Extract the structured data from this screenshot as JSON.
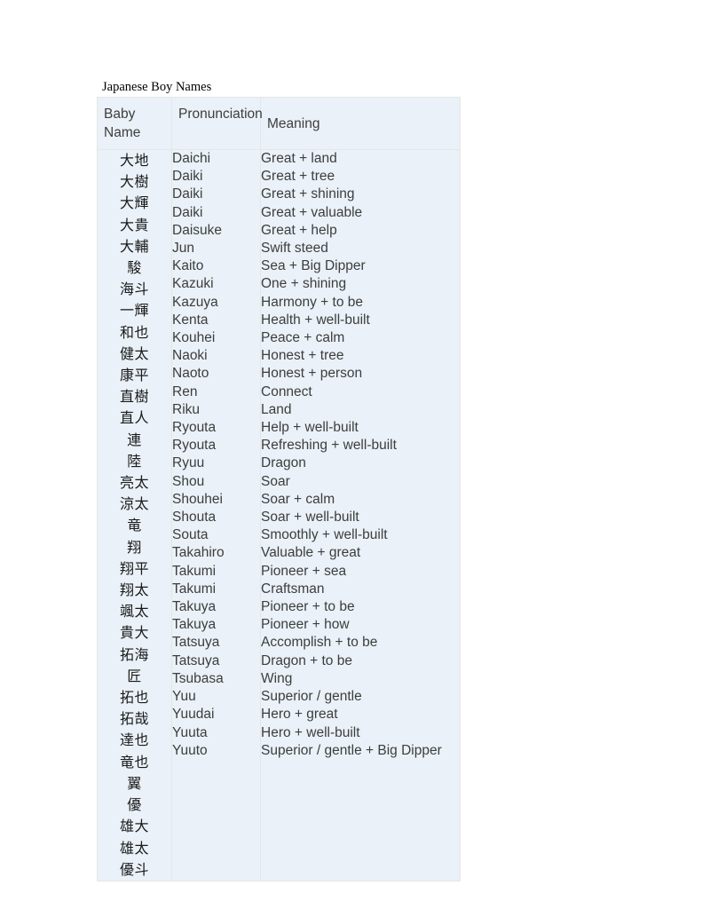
{
  "document": {
    "title": "Japanese Boy Names"
  },
  "table": {
    "headers": {
      "baby_name": "Baby Name",
      "pronunciation": "Pronunciation",
      "meaning": "Meaning"
    },
    "kanji": [
      "大地",
      "大樹",
      "大輝",
      "大貴",
      "大輔",
      "駿",
      "海斗",
      "一輝",
      "和也",
      "健太",
      "康平",
      "直樹",
      "直人",
      "連",
      "陸",
      "亮太",
      "涼太",
      "竜",
      "翔",
      "翔平",
      "翔太",
      "颯太",
      "貴大",
      "拓海",
      "匠",
      "拓也",
      "拓哉",
      "達也",
      "竜也",
      "翼",
      "優",
      "雄大",
      "雄太",
      "優斗"
    ],
    "pronunciation": [
      "Daichi",
      "Daiki",
      "Daiki",
      "Daiki",
      "Daisuke",
      "Jun",
      "Kaito",
      "Kazuki",
      "Kazuya",
      "Kenta",
      "Kouhei",
      "Naoki",
      "Naoto",
      "Ren",
      "Riku",
      "Ryouta",
      "Ryouta",
      "Ryuu",
      "Shou",
      "Shouhei",
      "Shouta",
      "Souta",
      "Takahiro",
      "Takumi",
      "Takumi",
      "Takuya",
      "Takuya",
      "Tatsuya",
      "Tatsuya",
      "Tsubasa",
      "Yuu",
      "Yuudai",
      "Yuuta",
      "Yuuto"
    ],
    "meaning": [
      "Great + land",
      "Great + tree",
      "Great + shining",
      "Great + valuable",
      "Great + help",
      "Swift steed",
      "Sea + Big Dipper",
      "One + shining",
      "Harmony + to be",
      "Health + well-built",
      "Peace + calm",
      "Honest + tree",
      "Honest + person",
      "Connect",
      "Land",
      "Help + well-built",
      "Refreshing + well-built",
      "Dragon",
      "Soar",
      "Soar + calm",
      "Soar + well-built",
      "Smoothly + well-built",
      "Valuable + great",
      "Pioneer + sea",
      "Craftsman",
      "Pioneer + to be",
      "Pioneer + how",
      "Accomplish + to be",
      "Dragon + to be",
      "Wing",
      "Superior / gentle",
      "Hero + great",
      "Hero + well-built",
      "Superior / gentle + Big Dipper"
    ]
  },
  "colors": {
    "cell_background": "#eaf1f8",
    "kanji_cell_background": "#ffffff",
    "border": "#e6e6e6",
    "text": "#3d3d3d",
    "title_text": "#000000"
  }
}
